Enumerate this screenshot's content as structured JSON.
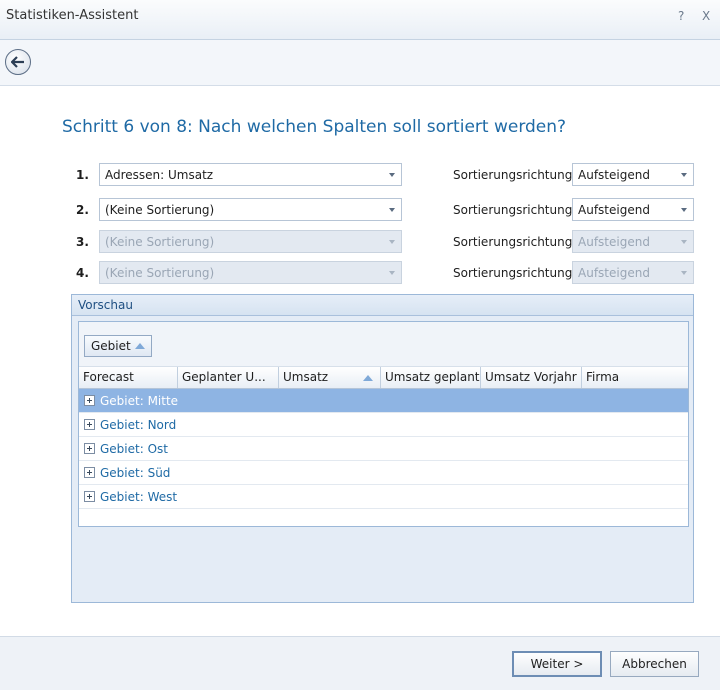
{
  "window": {
    "title": "Statistiken-Assistent",
    "help_glyph": "?",
    "close_glyph": "X"
  },
  "heading": "Schritt 6 von 8: Nach welchen Spalten soll sortiert werden?",
  "sort_label": "Sortierungsrichtung",
  "sort_rows": [
    {
      "num": "1.",
      "field": "Adressen: Umsatz",
      "direction": "Aufsteigend",
      "enabled": true
    },
    {
      "num": "2.",
      "field": "(Keine Sortierung)",
      "direction": "Aufsteigend",
      "enabled": true
    },
    {
      "num": "3.",
      "field": "(Keine Sortierung)",
      "direction": "Aufsteigend",
      "enabled": false
    },
    {
      "num": "4.",
      "field": "(Keine Sortierung)",
      "direction": "Aufsteigend",
      "enabled": false
    }
  ],
  "preview": {
    "title": "Vorschau",
    "group_chip": "Gebiet",
    "columns": [
      "Forecast",
      "Geplanter U...",
      "Umsatz",
      "Umsatz geplant",
      "Umsatz Vorjahr",
      "Firma"
    ],
    "groups": [
      "Gebiet: Mitte",
      "Gebiet: Nord",
      "Gebiet: Ost",
      "Gebiet: Süd",
      "Gebiet: West"
    ]
  },
  "buttons": {
    "next": "Weiter >",
    "cancel": "Abbrechen"
  },
  "colors": {
    "accent": "#1f6aa5",
    "selected_row": "#8eb4e3"
  }
}
